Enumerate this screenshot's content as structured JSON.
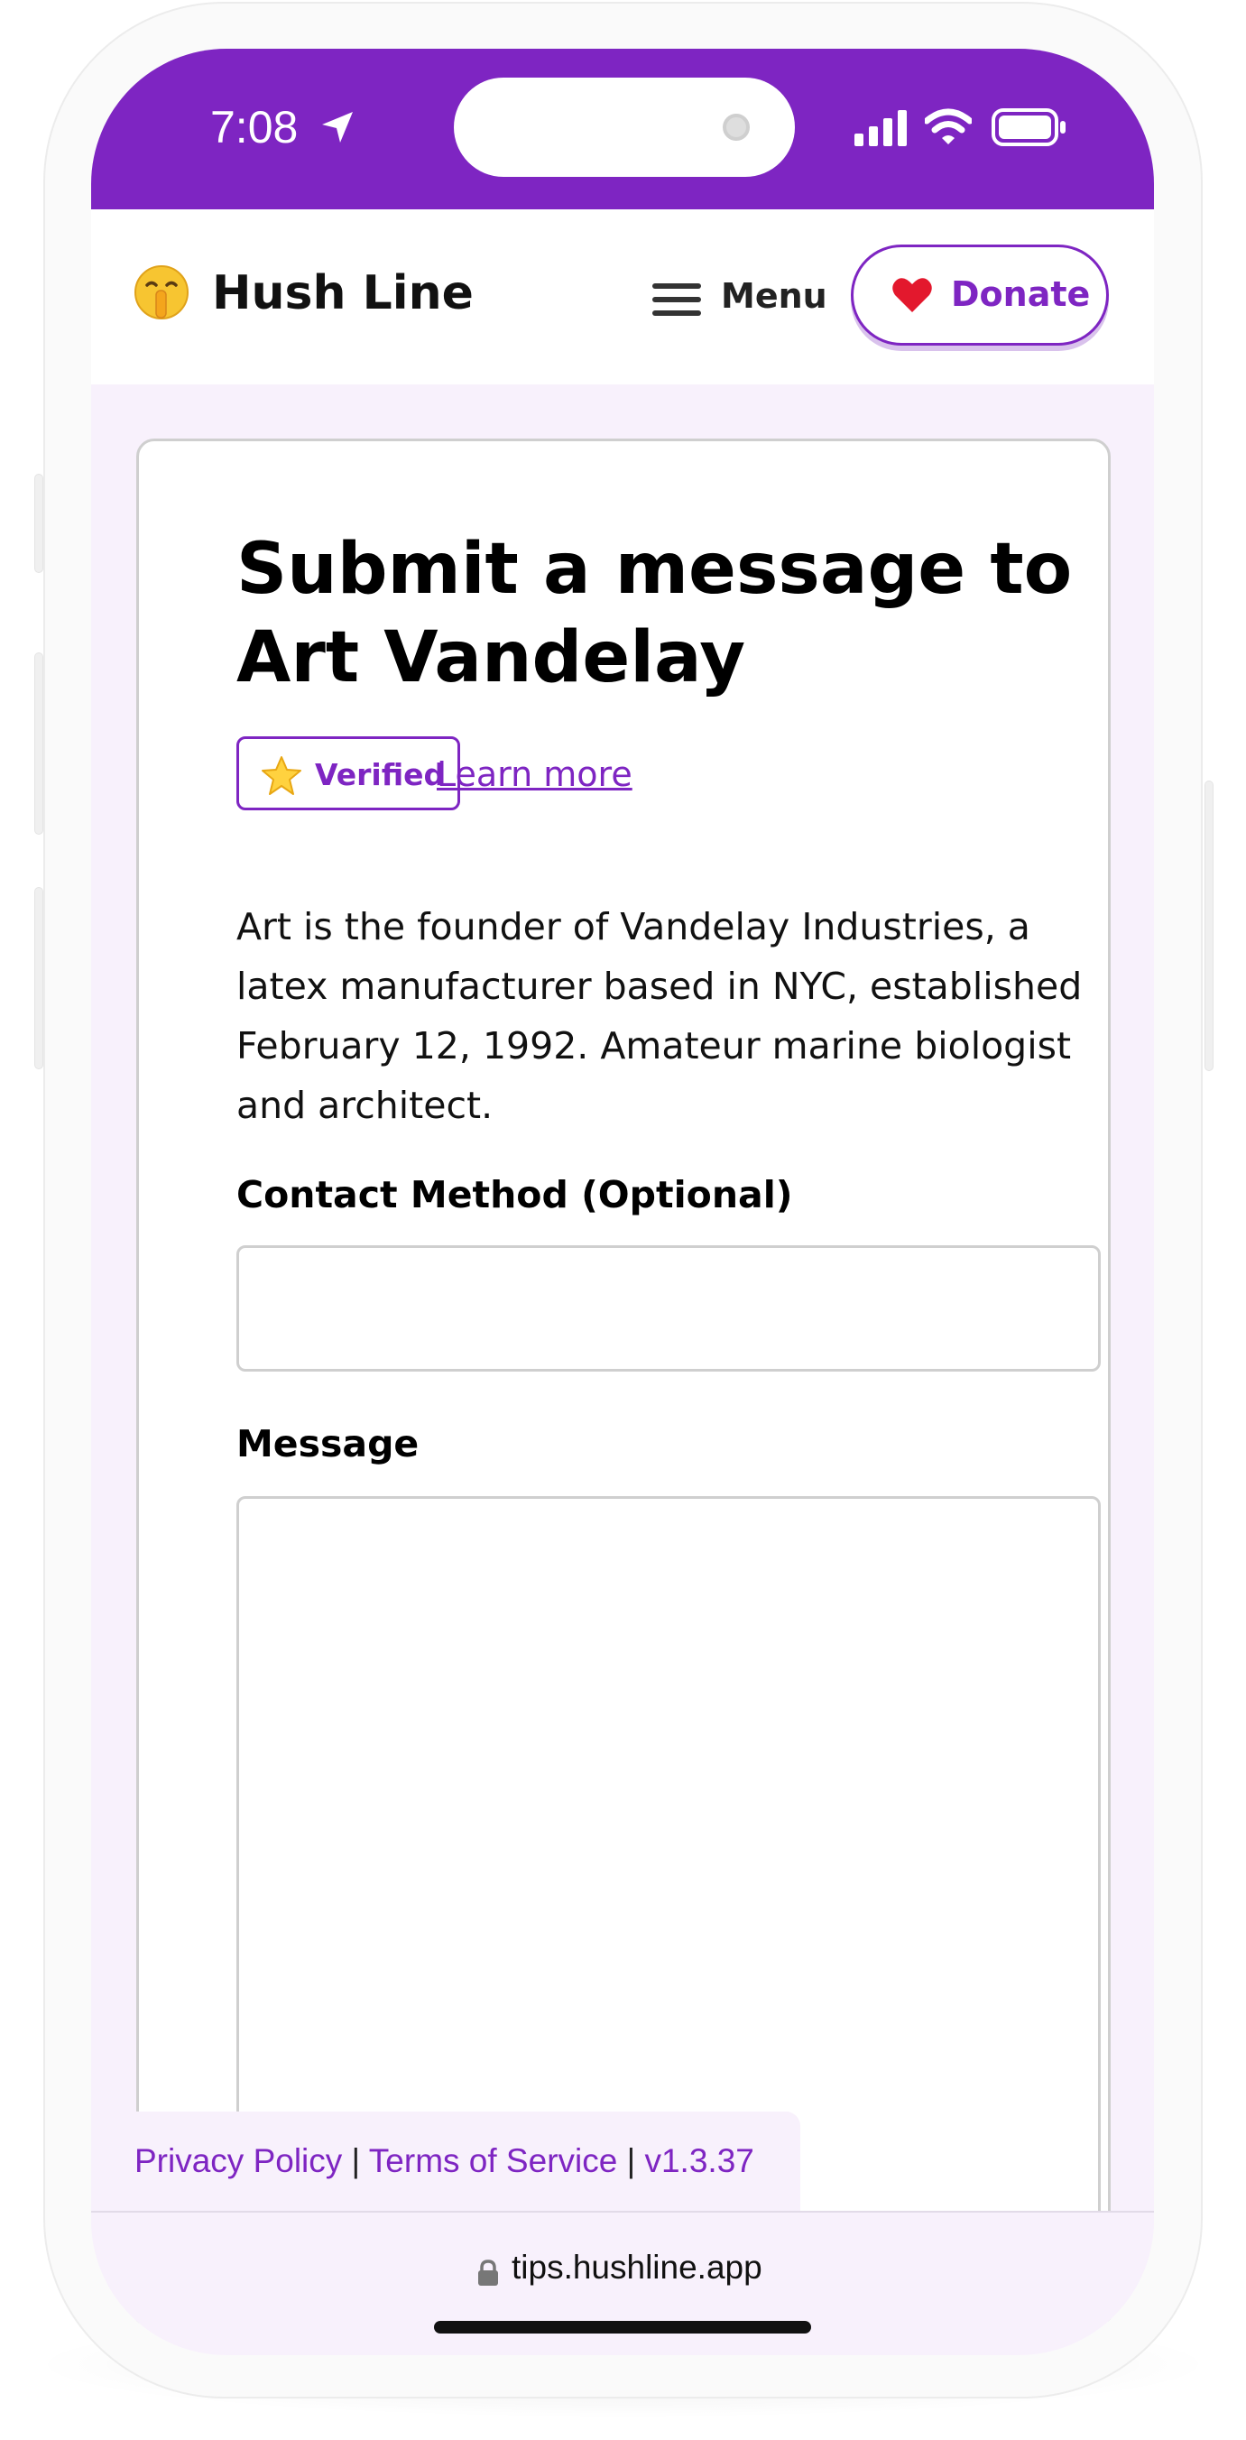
{
  "status_bar": {
    "time": "7:08",
    "icons": [
      "location-arrow-icon",
      "cellular-signal-icon",
      "wifi-icon",
      "battery-icon"
    ],
    "bar_color": "#7e25c2"
  },
  "header": {
    "logo_emoji": "shushing-face-icon",
    "brand": "Hush Line",
    "menu_label": "Menu",
    "donate_label": "Donate"
  },
  "profile": {
    "title": "Submit a message to Art Vandelay",
    "verified_label": "Verified",
    "learn_more": "Learn more",
    "bio": "Art is the founder of Vandelay Industries, a latex manufacturer based in NYC, established February 12, 1992. Amateur marine biologist and architect."
  },
  "form": {
    "contact_label": "Contact Method (Optional)",
    "contact_value": "",
    "message_label": "Message",
    "message_value": ""
  },
  "footer": {
    "privacy": "Privacy Policy",
    "separator1": " | ",
    "terms": "Terms of Service",
    "separator2": " | ",
    "version": "v1.3.37"
  },
  "browser": {
    "url": "tips.hushline.app"
  },
  "colors": {
    "accent": "#7e25c2",
    "page_background": "#f8f1fc",
    "border": "#cfcfcf"
  }
}
